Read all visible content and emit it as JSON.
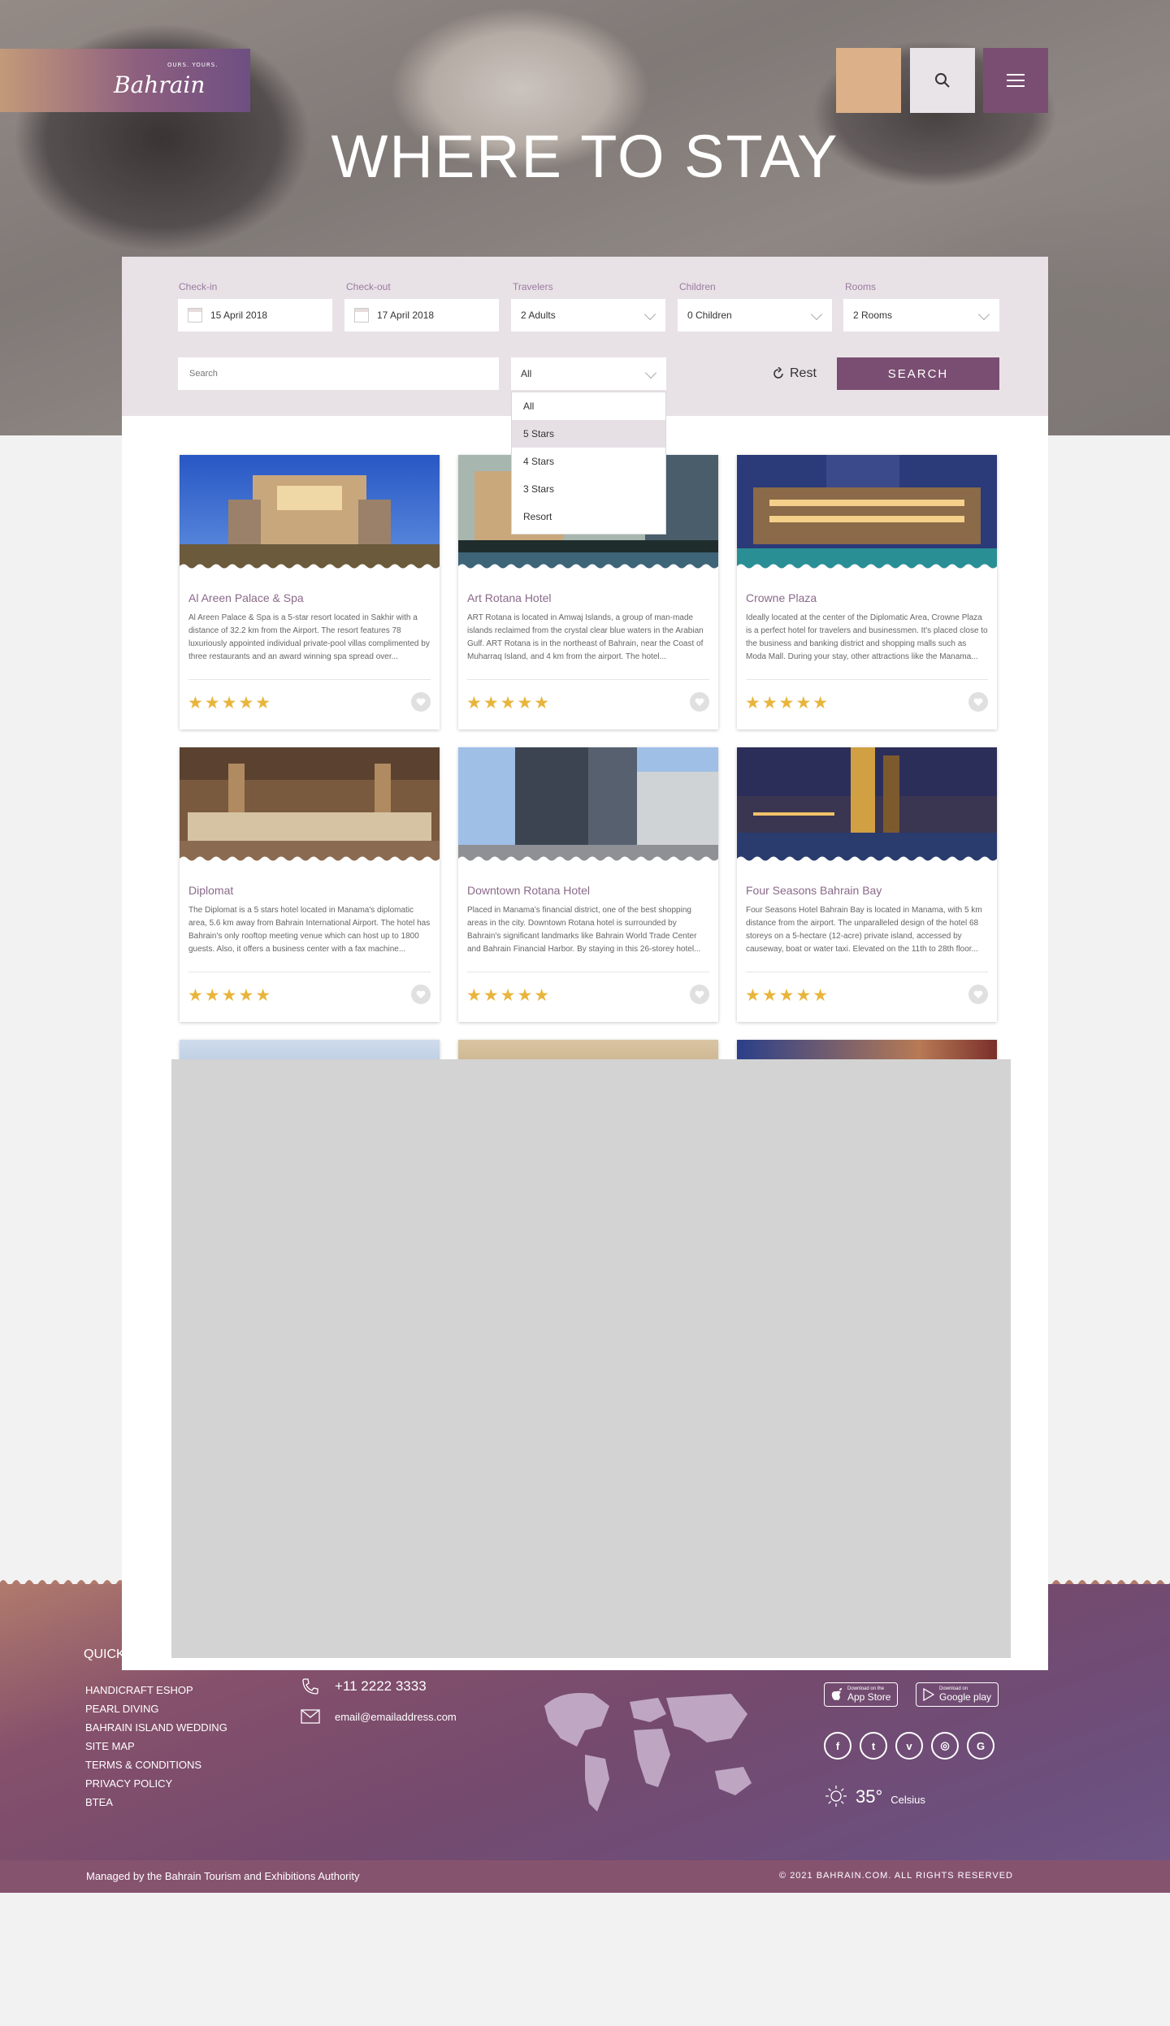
{
  "header": {
    "logo": {
      "text": "Bahrain",
      "tagline": "OURS. YOURS."
    },
    "title": "WHERE TO STAY"
  },
  "search": {
    "labels": {
      "checkin": "Check-in",
      "checkout": "Check-out",
      "travelers": "Travelers",
      "children": "Children",
      "rooms": "Rooms"
    },
    "values": {
      "checkin": "15 April 2018",
      "checkout": "17 April 2018",
      "travelers": "2 Adults",
      "children": "0 Children",
      "rooms": "2 Rooms"
    },
    "search_placeholder": "Search",
    "category_value": "All",
    "reset_label": "Rest",
    "search_button": "SEARCH",
    "dropdown_options": [
      "All",
      "5 Stars",
      "4 Stars",
      "3 Stars",
      "Resort"
    ],
    "dropdown_selected": "5 Stars"
  },
  "hotels": [
    {
      "name": "Al Areen Palace & Spa",
      "description": "Al Areen Palace & Spa is a 5-star resort located in Sakhir with a distance of 32.2 km from the Airport. The resort features 78 luxuriously appointed individual private-pool villas complimented by three restaurants and an award winning spa spread over...",
      "stars": "★★★★★"
    },
    {
      "name": "Art Rotana Hotel",
      "description": "ART Rotana is located in Amwaj Islands, a group of man-made islands reclaimed from the crystal clear blue waters in the Arabian Gulf. ART Rotana is in the northeast of Bahrain, near the Coast of Muharraq Island, and 4 km from the airport. The hotel...",
      "stars": "★★★★★"
    },
    {
      "name": "Crowne Plaza",
      "description": "Ideally located at the center of the Diplomatic Area, Crowne Plaza is a perfect hotel for travelers and businessmen. It's placed close to the business and banking district and shopping malls such as Moda Mall. During your stay, other attractions like the Manama...",
      "stars": "★★★★★"
    },
    {
      "name": "Diplomat",
      "description": "The Diplomat is a 5 stars hotel located in Manama's diplomatic area, 5.6 km away from Bahrain International Airport. The hotel has Bahrain's only rooftop meeting venue which can host up to 1800 guests. Also, it offers a business center with a fax machine...",
      "stars": "★★★★★"
    },
    {
      "name": "Downtown Rotana Hotel",
      "description": "Placed in Manama's financial district, one of the best shopping areas in the city. Downtown Rotana hotel is surrounded by Bahrain's significant landmarks like Bahrain World Trade Center and Bahrain Financial Harbor. By staying in this 26-storey hotel...",
      "stars": "★★★★★"
    },
    {
      "name": "Four Seasons Bahrain Bay",
      "description": "Four Seasons Hotel Bahrain Bay is located in Manama, with 5 km distance from the airport. The unparalleled design of the hotel 68 storeys on a 5-hectare (12-acre) private island, accessed by causeway, boat or water taxi. Elevated on the 11th to 28th floor...",
      "stars": "★★★★★"
    }
  ],
  "footer": {
    "quick_links_title": "QUICK",
    "quick_links": [
      "HANDICRAFT ESHOP",
      "PEARL DIVING",
      "BAHRAIN ISLAND WEDDING",
      "SITE MAP",
      "TERMS & CONDITIONS",
      "PRIVACY POLICY",
      "BTEA"
    ],
    "phone": "+11 2222 3333",
    "email": "email@emailaddress.com",
    "app_store": {
      "small": "Download on the",
      "big": "App Store"
    },
    "google_play": {
      "small": "Download on",
      "big": "Google play"
    },
    "social": [
      "f",
      "t",
      "v",
      "◎",
      "G"
    ],
    "weather": {
      "temp": "35°",
      "unit": "Celsius"
    },
    "managed_by": "Managed by the Bahrain Tourism and Exhibitions Authority",
    "copyright": "© 2021 BAHRAIN.COM. ALL RIGHTS RESERVED"
  }
}
